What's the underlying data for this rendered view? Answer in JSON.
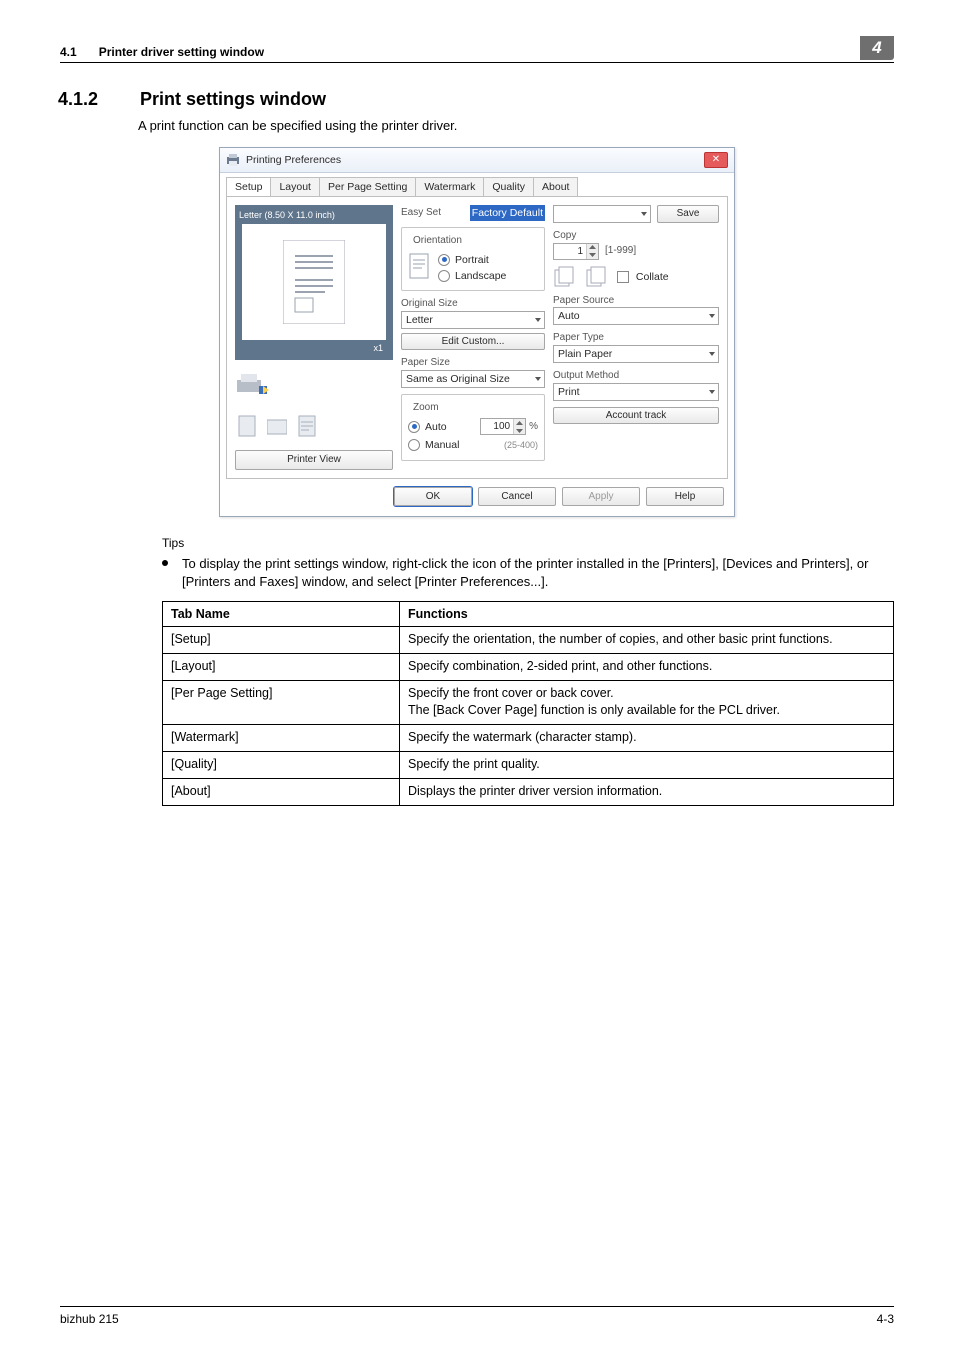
{
  "header": {
    "section_number": "4.1",
    "section_title": "Printer driver setting window",
    "badge": "4"
  },
  "section": {
    "number": "4.1.2",
    "title": "Print settings window",
    "intro": "A print function can be specified using the printer driver."
  },
  "dialog": {
    "title": "Printing Preferences",
    "tabs": [
      "Setup",
      "Layout",
      "Per Page Setting",
      "Watermark",
      "Quality",
      "About"
    ],
    "active_tab_index": 0,
    "preview": {
      "paper_label": "Letter  (8.50 X 11.0 inch)",
      "multiplier": "x1",
      "printer_view_btn": "Printer View"
    },
    "easy_set": {
      "label": "Easy Set",
      "selected": "Factory Default",
      "save_btn": "Save"
    },
    "orientation": {
      "legend": "Orientation",
      "portrait": "Portrait",
      "landscape": "Landscape",
      "selected": "portrait"
    },
    "original_size": {
      "label": "Original Size",
      "value": "Letter",
      "edit_btn": "Edit Custom..."
    },
    "paper_size": {
      "label": "Paper Size",
      "value": "Same as Original Size"
    },
    "zoom": {
      "legend": "Zoom",
      "auto": "Auto",
      "manual": "Manual",
      "value": "100",
      "unit": "%",
      "range": "(25-400)",
      "selected": "auto"
    },
    "copy": {
      "label": "Copy",
      "value": "1",
      "range": "[1-999]",
      "collate": "Collate"
    },
    "paper_source": {
      "label": "Paper Source",
      "value": "Auto"
    },
    "paper_type": {
      "label": "Paper Type",
      "value": "Plain Paper"
    },
    "output_method": {
      "label": "Output Method",
      "value": "Print"
    },
    "account_track_btn": "Account track",
    "buttons": {
      "ok": "OK",
      "cancel": "Cancel",
      "apply": "Apply",
      "help": "Help"
    }
  },
  "tips": {
    "heading": "Tips",
    "bullet": "To display the print settings window, right-click the icon of the printer installed in the [Printers], [Devices and Printers], or [Printers and Faxes] window, and select [Printer Preferences...]."
  },
  "table": {
    "headers": [
      "Tab Name",
      "Functions"
    ],
    "rows": [
      [
        "[Setup]",
        "Specify the orientation, the number of copies, and other basic print functions."
      ],
      [
        "[Layout]",
        "Specify combination, 2-sided print, and other functions."
      ],
      [
        "[Per Page Setting]",
        "Specify the front cover or back cover.\nThe [Back Cover Page] function is only available for the PCL driver."
      ],
      [
        "[Watermark]",
        "Specify the watermark (character stamp)."
      ],
      [
        "[Quality]",
        "Specify the print quality."
      ],
      [
        "[About]",
        "Displays the printer driver version information."
      ]
    ]
  },
  "footer": {
    "product": "bizhub 215",
    "page": "4-3"
  }
}
